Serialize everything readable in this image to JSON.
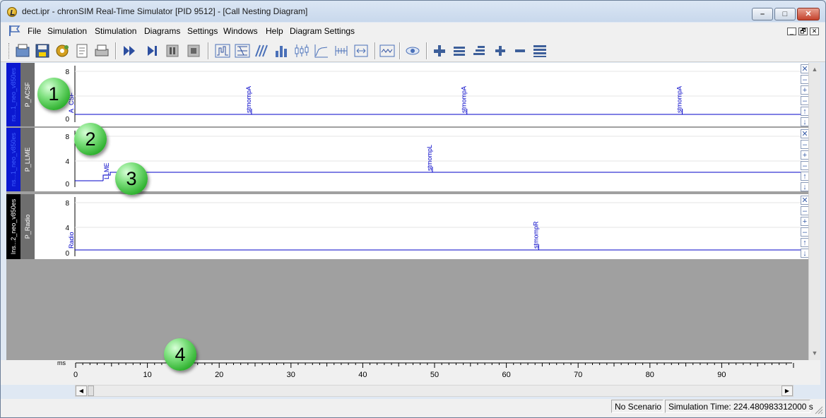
{
  "window": {
    "title": "dect.ipr - chronSIM Real-Time Simulator [PID 9512] - [Call Nesting Diagram]",
    "controls": {
      "minimize": "–",
      "maximize": "□",
      "close": "✕"
    }
  },
  "menu": {
    "items": [
      "File",
      "Simulation",
      "Stimulation",
      "Diagrams",
      "Settings",
      "Windows",
      "Help",
      "Diagram Settings"
    ],
    "mdi": {
      "minimize": "_",
      "restore": "🗗",
      "close": "✕"
    }
  },
  "toolbar": {
    "icons": [
      "open-icon",
      "save-icon",
      "settings-gear-icon",
      "report-icon",
      "print-icon",
      "fast-forward-icon",
      "step-icon",
      "pause-icon",
      "stop-icon",
      "call-nesting-icon",
      "state-diagram-icon",
      "timing-icon",
      "histogram-icon",
      "candlestick-icon",
      "line-chart-icon",
      "range-icon",
      "fit-icon",
      "wave-icon",
      "eye-icon",
      "add-lane-icon",
      "align-icon",
      "stack-icon",
      "plus-icon",
      "minus-icon",
      "list-icon"
    ]
  },
  "lanes": [
    {
      "outer_label": "ns...1_neo_v850es",
      "name": "P_ACSF",
      "ticks": [
        "8",
        "4",
        "0"
      ],
      "baseline_label": "A_CSF",
      "events": [
        {
          "t": 24.5,
          "label": "stmompA"
        },
        {
          "t": 54.5,
          "label": "stmompA"
        },
        {
          "t": 84.5,
          "label": "stmompA"
        }
      ]
    },
    {
      "outer_label": "ns...1_neo_v850es",
      "name": "P_LLME",
      "ticks": [
        "8",
        "4",
        "0"
      ],
      "baseline_label": "LLME",
      "events": [
        {
          "t": 49.7,
          "label": "stmompL"
        }
      ]
    },
    {
      "outer_label": "Ins...2_neo_v850es",
      "name": "P_Radio",
      "ticks": [
        "8",
        "4",
        "0"
      ],
      "baseline_label": "Radio",
      "events": [
        {
          "t": 64.5,
          "label": "stmompR"
        }
      ]
    }
  ],
  "side_controls": [
    "✕",
    "–",
    "+",
    "–",
    "↑",
    "↓"
  ],
  "time_axis": {
    "unit": "ms",
    "labels": [
      "0",
      "10",
      "20",
      "30",
      "40",
      "50",
      "60",
      "70",
      "80",
      "90"
    ],
    "range": [
      0,
      100
    ]
  },
  "statusbar": {
    "scenario": "No Scenario",
    "sim_time": "Simulation Time: 224.480983312000 s"
  },
  "callouts": [
    "1",
    "2",
    "3",
    "4"
  ]
}
